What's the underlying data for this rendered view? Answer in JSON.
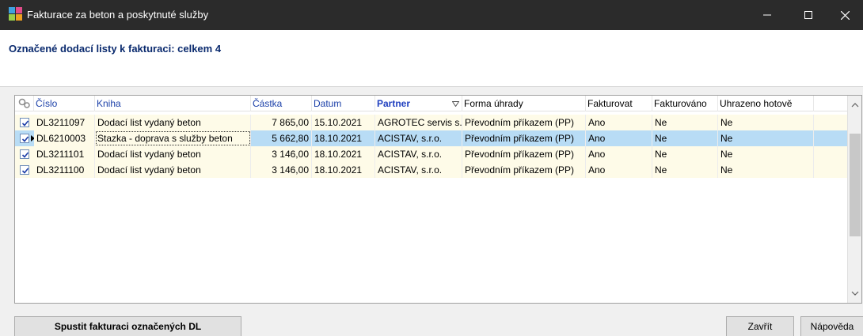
{
  "window": {
    "title": "Fakturace za beton a poskytnuté služby",
    "minimize_glyph": "—",
    "maximize_glyph": "☐",
    "close_glyph": "✕"
  },
  "header": {
    "text": "Označené dodací listy k fakturaci: celkem 4"
  },
  "grid": {
    "columns": {
      "cislo": "Číslo",
      "kniha": "Kniha",
      "castka": "Částka",
      "datum": "Datum",
      "partner": "Partner",
      "forma": "Forma úhrady",
      "fakturovat": "Fakturovat",
      "fakturovano": "Fakturováno",
      "uhrazeno": "Uhrazeno hotově"
    },
    "rows": [
      {
        "cislo": "DL3211097",
        "kniha": "Dodací list vydaný beton",
        "castka": "7 865,00",
        "datum": "15.10.2021",
        "partner": "AGROTEC servis s.r.o.",
        "forma": "Převodním příkazem (PP)",
        "fakturovat": "Ano",
        "fakturovano": "Ne",
        "uhrazeno": "Ne",
        "checked": true
      },
      {
        "cislo": "DL6210003",
        "kniha": "Stazka - doprava s služby beton",
        "castka": "5 662,80",
        "datum": "18.10.2021",
        "partner": "ACISTAV, s.r.o.",
        "forma": "Převodním příkazem (PP)",
        "fakturovat": "Ano",
        "fakturovano": "Ne",
        "uhrazeno": "Ne",
        "checked": true
      },
      {
        "cislo": "DL3211101",
        "kniha": "Dodací list vydaný beton",
        "castka": "3 146,00",
        "datum": "18.10.2021",
        "partner": "ACISTAV, s.r.o.",
        "forma": "Převodním příkazem (PP)",
        "fakturovat": "Ano",
        "fakturovano": "Ne",
        "uhrazeno": "Ne",
        "checked": true
      },
      {
        "cislo": "DL3211100",
        "kniha": "Dodací list vydaný beton",
        "castka": "3 146,00",
        "datum": "18.10.2021",
        "partner": "ACISTAV, s.r.o.",
        "forma": "Převodním příkazem (PP)",
        "fakturovat": "Ano",
        "fakturovano": "Ne",
        "uhrazeno": "Ne",
        "checked": true
      }
    ]
  },
  "buttons": {
    "run": "Spustit fakturaci označených DL",
    "close": "Zavřít",
    "help": "Nápověda"
  },
  "colors": {
    "titlebar": "#2b2b2b",
    "header_text": "#0a2a6e",
    "row_bg": "#fefbe8",
    "row_selected": "#b8dcf5",
    "column_header": "#1a3fa8"
  }
}
